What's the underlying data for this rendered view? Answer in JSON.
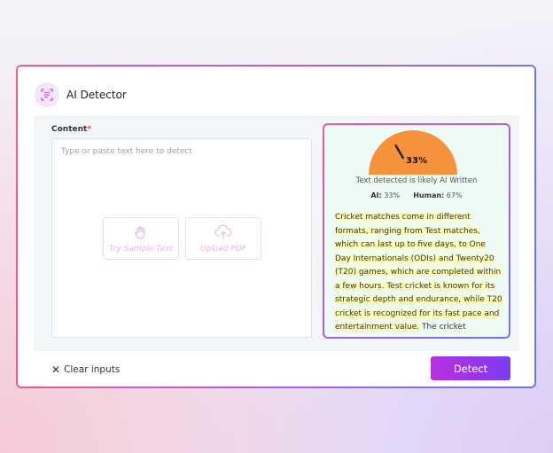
{
  "app": {
    "title": "AI Detector",
    "logo_icon": "document-scan-icon"
  },
  "input": {
    "label": "Content",
    "required_marker": "*",
    "placeholder": "Type or paste text here to detect",
    "sample_button": {
      "label": "Try Sample Text",
      "icon": "hand-wave-icon"
    },
    "upload_button": {
      "label": "Upload PDF",
      "icon": "cloud-upload-icon"
    }
  },
  "result": {
    "score_label": "33%",
    "ai_fraction": 0.33,
    "verdict": "Text detected is likely AI Written",
    "ai_label": "AI:",
    "ai_value": "33%",
    "human_label": "Human:",
    "human_value": "67%",
    "highlighted_text": "Cricket matches come in different formats, ranging from Test matches, which can last up to five days, to One Day Internationals (ODIs) and Twenty20 (T20) games, which are completed within a few hours. Test cricket is known for its strategic depth and endurance, while T20 cricket is recognized for its fast pace and entertainment value.",
    "plain_text": " The cricket lightwood approach in disparate formats",
    "colors": {
      "gauge": "#f5923b",
      "highlight": "#fafcb8",
      "background": "#eefaf4"
    }
  },
  "footer": {
    "clear_label": "Clear inputs",
    "detect_label": "Detect"
  },
  "colors": {
    "accent": "#b830e0",
    "accent_end": "#7b3cf0"
  }
}
